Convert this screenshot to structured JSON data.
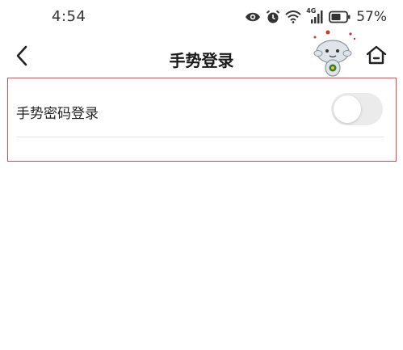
{
  "status_bar": {
    "time": "4:54",
    "network_label": "4G",
    "battery_percent": "57%",
    "icons": [
      "eye-icon",
      "alarm-icon",
      "wifi-icon",
      "signal-icon",
      "battery-icon"
    ]
  },
  "header": {
    "title": "手势登录",
    "back_icon": "chevron-left-icon",
    "home_icon": "home-icon",
    "mascot": "mascot-image"
  },
  "settings": {
    "items": [
      {
        "label": "手势密码登录",
        "enabled": false
      }
    ]
  },
  "colors": {
    "highlight_border": "#e5484d",
    "toggle_off_track": "#ebebeb",
    "divider": "#e6e6e6"
  }
}
